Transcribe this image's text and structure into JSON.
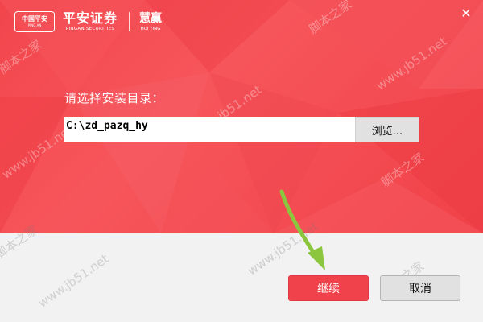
{
  "branding": {
    "logo_line1": "中国平安",
    "logo_line2": "PING AN",
    "brand_cn": "平安证券",
    "brand_en": "PINGAN SECURITIES",
    "product_cn": "慧赢",
    "product_en": "HUI YING"
  },
  "window": {
    "close_glyph": "✕"
  },
  "install": {
    "label": "请选择安装目录：",
    "path_value": "C:\\zd_pazq_hy",
    "browse_label": "浏览..."
  },
  "footer": {
    "continue_label": "继续",
    "cancel_label": "取消"
  },
  "watermarks": {
    "site": "www.jb51.net",
    "name": "脚本之家"
  },
  "colors": {
    "primary_red": "#f0424a",
    "footer_bg": "#f2f2f2",
    "arrow_green": "#8cc63f"
  }
}
